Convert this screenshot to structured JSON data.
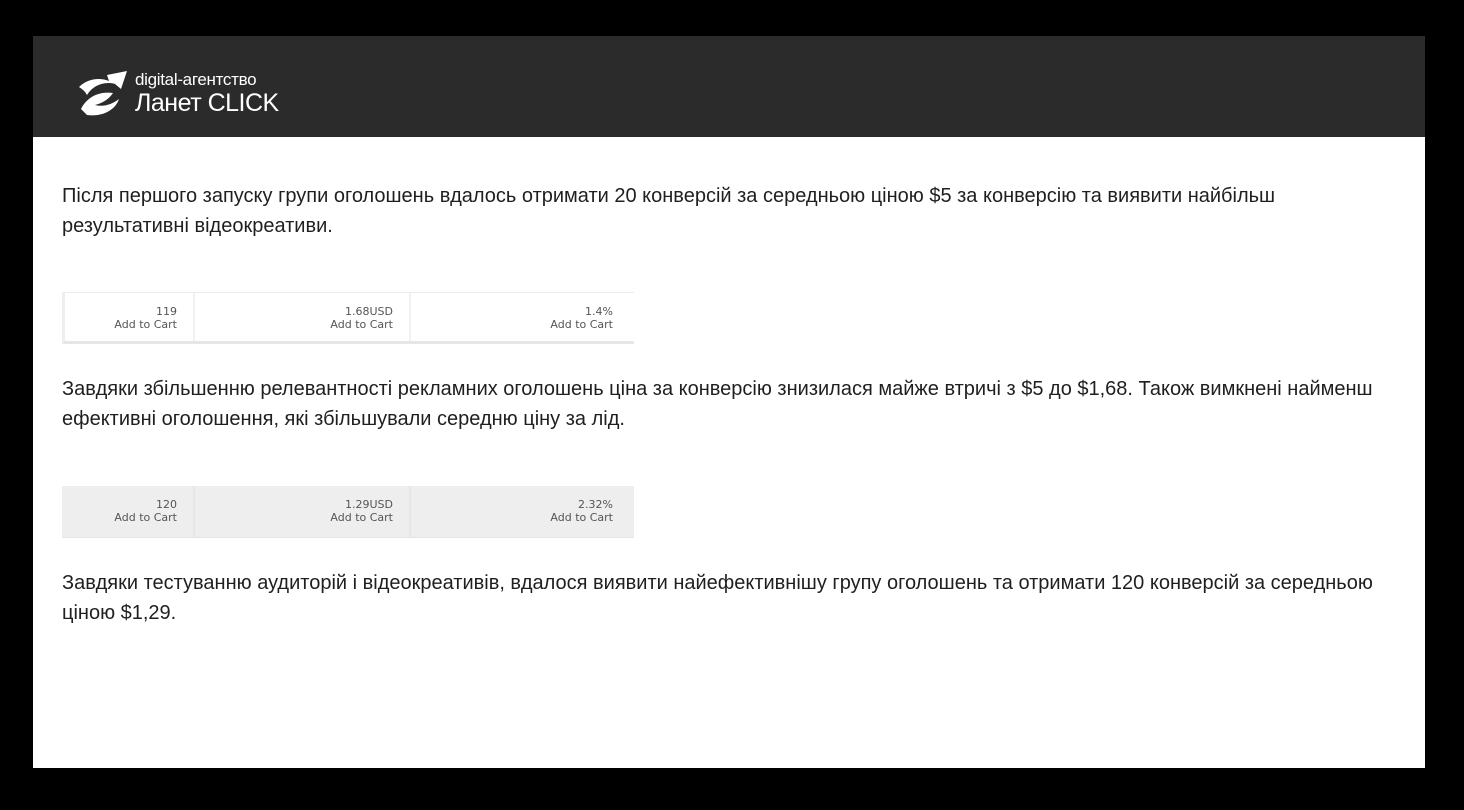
{
  "header": {
    "logo_subtitle": "digital-агентство",
    "logo_title": "Ланет CLICK",
    "logo_icon": "swoosh-arrow-icon"
  },
  "paragraphs": [
    "Після першого запуску групи оголошень вдалось отримати 20 конверсій за середньою ціною $5 за конверсію та виявити найбільш результативні відеокреативи.",
    "Завдяки збільшенню релевантності рекламних оголошень ціна за конверсію знизилася майже втричі з $5 до $1,68. Також вимкнені найменш ефективні оголошення, які збільшували середню ціну за лід.",
    "Завдяки тестуванню аудиторій і відеокреативів, вдалося виявити найефективнішу групу оголошень та отримати 120 конверсій за середньою ціною $1,29."
  ],
  "stats_tables": [
    {
      "cells": [
        {
          "value": "119",
          "label": "Add to Cart"
        },
        {
          "value": "1.68USD",
          "label": "Add to Cart"
        },
        {
          "value": "1.4%",
          "label": "Add to Cart"
        }
      ]
    },
    {
      "cells": [
        {
          "value": "120",
          "label": "Add to Cart"
        },
        {
          "value": "1.29USD",
          "label": "Add to Cart"
        },
        {
          "value": "2.32%",
          "label": "Add to Cart"
        }
      ]
    }
  ],
  "colors": {
    "background": "#000000",
    "header": "#2b2b2b",
    "page": "#ffffff",
    "text": "#1f1f1f"
  }
}
